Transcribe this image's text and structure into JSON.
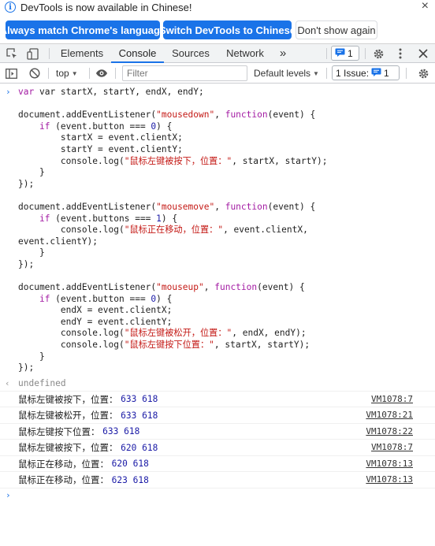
{
  "infobar": {
    "message": "DevTools is now available in Chinese!",
    "btn_match": "Always match Chrome's language",
    "btn_switch": "Switch DevTools to Chinese",
    "btn_dont_show": "Don't show again",
    "close": "×"
  },
  "tabs": {
    "elements": "Elements",
    "console": "Console",
    "sources": "Sources",
    "network": "Network",
    "more": "»",
    "messages_count": "1"
  },
  "filterbar": {
    "context": "top",
    "filter_placeholder": "Filter",
    "levels": "Default levels",
    "issues_label": "1 Issue:",
    "issues_count": "1"
  },
  "console_input": {
    "l1": "var startX, startY, endX, endY;",
    "l3a": "document.addEventListener(",
    "l3s": "\"mousedown\"",
    "l3b": ", ",
    "l3k": "function",
    "l3c": "(event) {",
    "l4k": "if",
    "l4a": " (event.button === ",
    "l4n": "0",
    "l4b": ") {",
    "l5": "startX = event.clientX;",
    "l6": "startY = event.clientY;",
    "l7a": "console.log(",
    "l7s": "\"鼠标左键被按下，位置：\"",
    "l7b": ", startX, startY);",
    "l8": "}",
    "l9": "});",
    "l11s": "\"mousemove\"",
    "l12a": " (event.buttons === ",
    "l12n": "1",
    "l13s": "\"鼠标正在移动，位置：\"",
    "l13b": ", event.clientX,",
    "l14": "event.clientY);",
    "l18s": "\"mouseup\"",
    "l20": "endX = event.clientX;",
    "l21": "endY = event.clientY;",
    "l22s": "\"鼠标左键被松开，位置：\"",
    "l22b": ", endX, endY);",
    "l23s": "\"鼠标左键按下位置：\"",
    "l23b": ", startX, startY);"
  },
  "result": "undefined",
  "logs": [
    {
      "text": "鼠标左键被按下，位置： ",
      "nums": "633 618",
      "src": "VM1078:7"
    },
    {
      "text": "鼠标左键被松开，位置： ",
      "nums": "633 618",
      "src": "VM1078:21"
    },
    {
      "text": "鼠标左键按下位置： ",
      "nums": "633 618",
      "src": "VM1078:22"
    },
    {
      "text": "鼠标左键被按下，位置： ",
      "nums": "620 618",
      "src": "VM1078:7"
    },
    {
      "text": "鼠标正在移动，位置： ",
      "nums": "620 618",
      "src": "VM1078:13"
    },
    {
      "text": "鼠标正在移动，位置： ",
      "nums": "623 618",
      "src": "VM1078:13"
    }
  ],
  "colors": {
    "accent": "#1a73e8",
    "keyword": "#a31ba3",
    "string": "#c41a16",
    "number": "#1a1aa6"
  }
}
